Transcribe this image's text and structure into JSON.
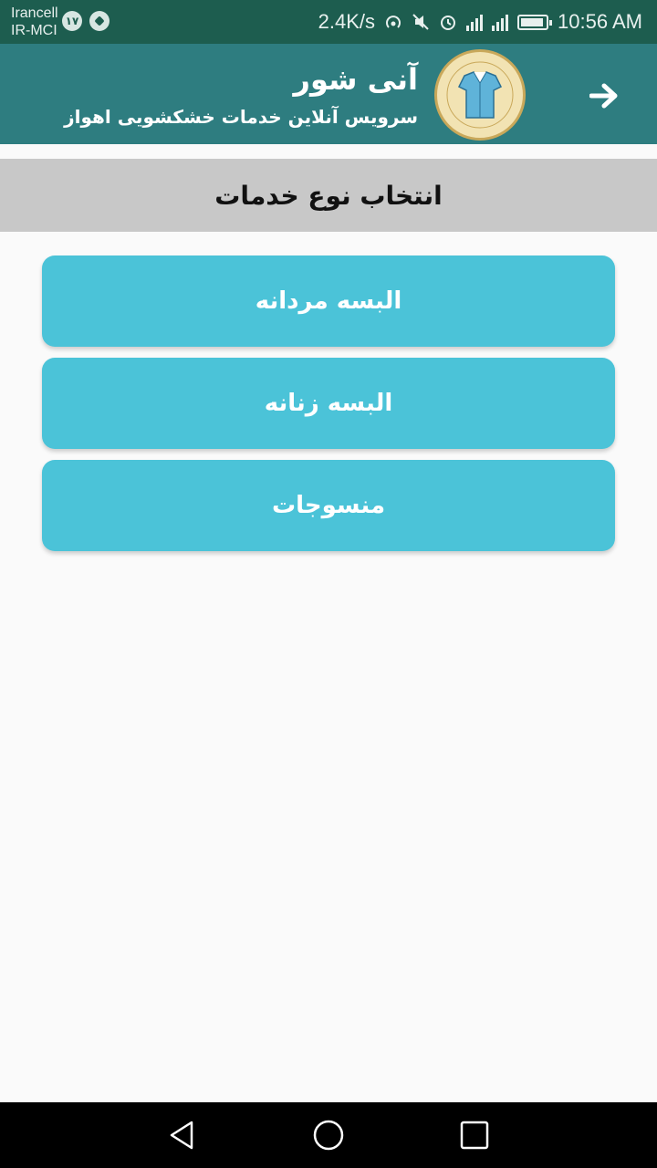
{
  "status_bar": {
    "carrier1": "Irancell",
    "carrier2": "IR-MCI",
    "badge": "۱۷",
    "speed": "2.4K/s",
    "time": "10:56 AM"
  },
  "app_bar": {
    "title": "آنی شور",
    "subtitle": "سرویس آنلاین خدمات خشکشویی اهواز",
    "logo_text": "آنی شور"
  },
  "section": {
    "title": "انتخاب نوع خدمات"
  },
  "options": [
    {
      "label": "البسه مردانه"
    },
    {
      "label": "البسه زنانه"
    },
    {
      "label": "منسوجات"
    }
  ],
  "colors": {
    "status_bar": "#1d5d4f",
    "app_bar": "#2e7d80",
    "section_header": "#c8c8c8",
    "button": "#4bc3d8"
  }
}
